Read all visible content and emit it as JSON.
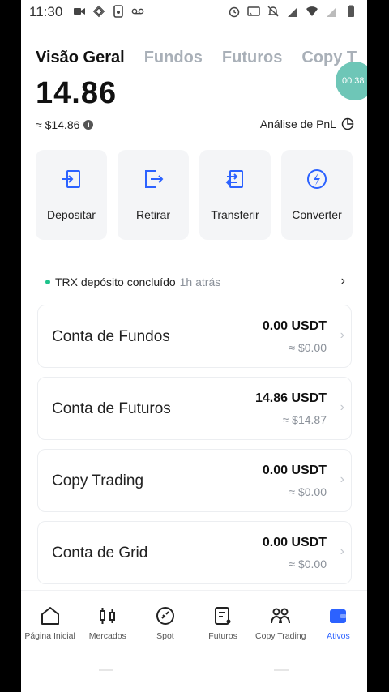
{
  "status_bar": {
    "time": "11:30",
    "left_icons": [
      "video-icon",
      "binance-icon",
      "phone-icon",
      "voicemail-icon"
    ],
    "right_icons": [
      "alarm-icon",
      "cast-icon",
      "mute-icon",
      "signal-4g-icon",
      "wifi-icon",
      "signal-icon",
      "battery-icon"
    ]
  },
  "tabs": [
    {
      "label": "Visão Geral",
      "active": true
    },
    {
      "label": "Fundos",
      "active": false
    },
    {
      "label": "Futuros",
      "active": false
    },
    {
      "label": "Copy T",
      "active": false
    }
  ],
  "timer": "00:38",
  "summary": {
    "balance": "14.86",
    "approx": "≈ $14.86",
    "pnl_label": "Análise de PnL"
  },
  "actions": [
    {
      "label": "Depositar",
      "icon": "deposit-icon"
    },
    {
      "label": "Retirar",
      "icon": "withdraw-icon"
    },
    {
      "label": "Transferir",
      "icon": "transfer-icon"
    },
    {
      "label": "Converter",
      "icon": "convert-icon"
    }
  ],
  "notice": {
    "text": "TRX depósito concluído",
    "time": "1h atrás"
  },
  "accounts": [
    {
      "name": "Conta de Fundos",
      "amount": "0.00 USDT",
      "fiat": "≈ $0.00"
    },
    {
      "name": "Conta de Futuros",
      "amount": "14.86 USDT",
      "fiat": "≈ $14.87"
    },
    {
      "name": "Copy Trading",
      "amount": "0.00 USDT",
      "fiat": "≈ $0.00"
    },
    {
      "name": "Conta de Grid",
      "amount": "0.00 USDT",
      "fiat": "≈ $0.00"
    }
  ],
  "bottom_nav": [
    {
      "label": "Página Inicial",
      "icon": "home-icon",
      "active": false
    },
    {
      "label": "Mercados",
      "icon": "markets-icon",
      "active": false
    },
    {
      "label": "Spot",
      "icon": "spot-icon",
      "active": false
    },
    {
      "label": "Futuros",
      "icon": "futures-icon",
      "active": false
    },
    {
      "label": "Copy Trading",
      "icon": "copy-trading-icon",
      "active": false
    },
    {
      "label": "Ativos",
      "icon": "assets-icon",
      "active": true
    }
  ],
  "colors": {
    "accent": "#2c62ff",
    "success": "#1ec38b",
    "muted": "#8a9099"
  }
}
